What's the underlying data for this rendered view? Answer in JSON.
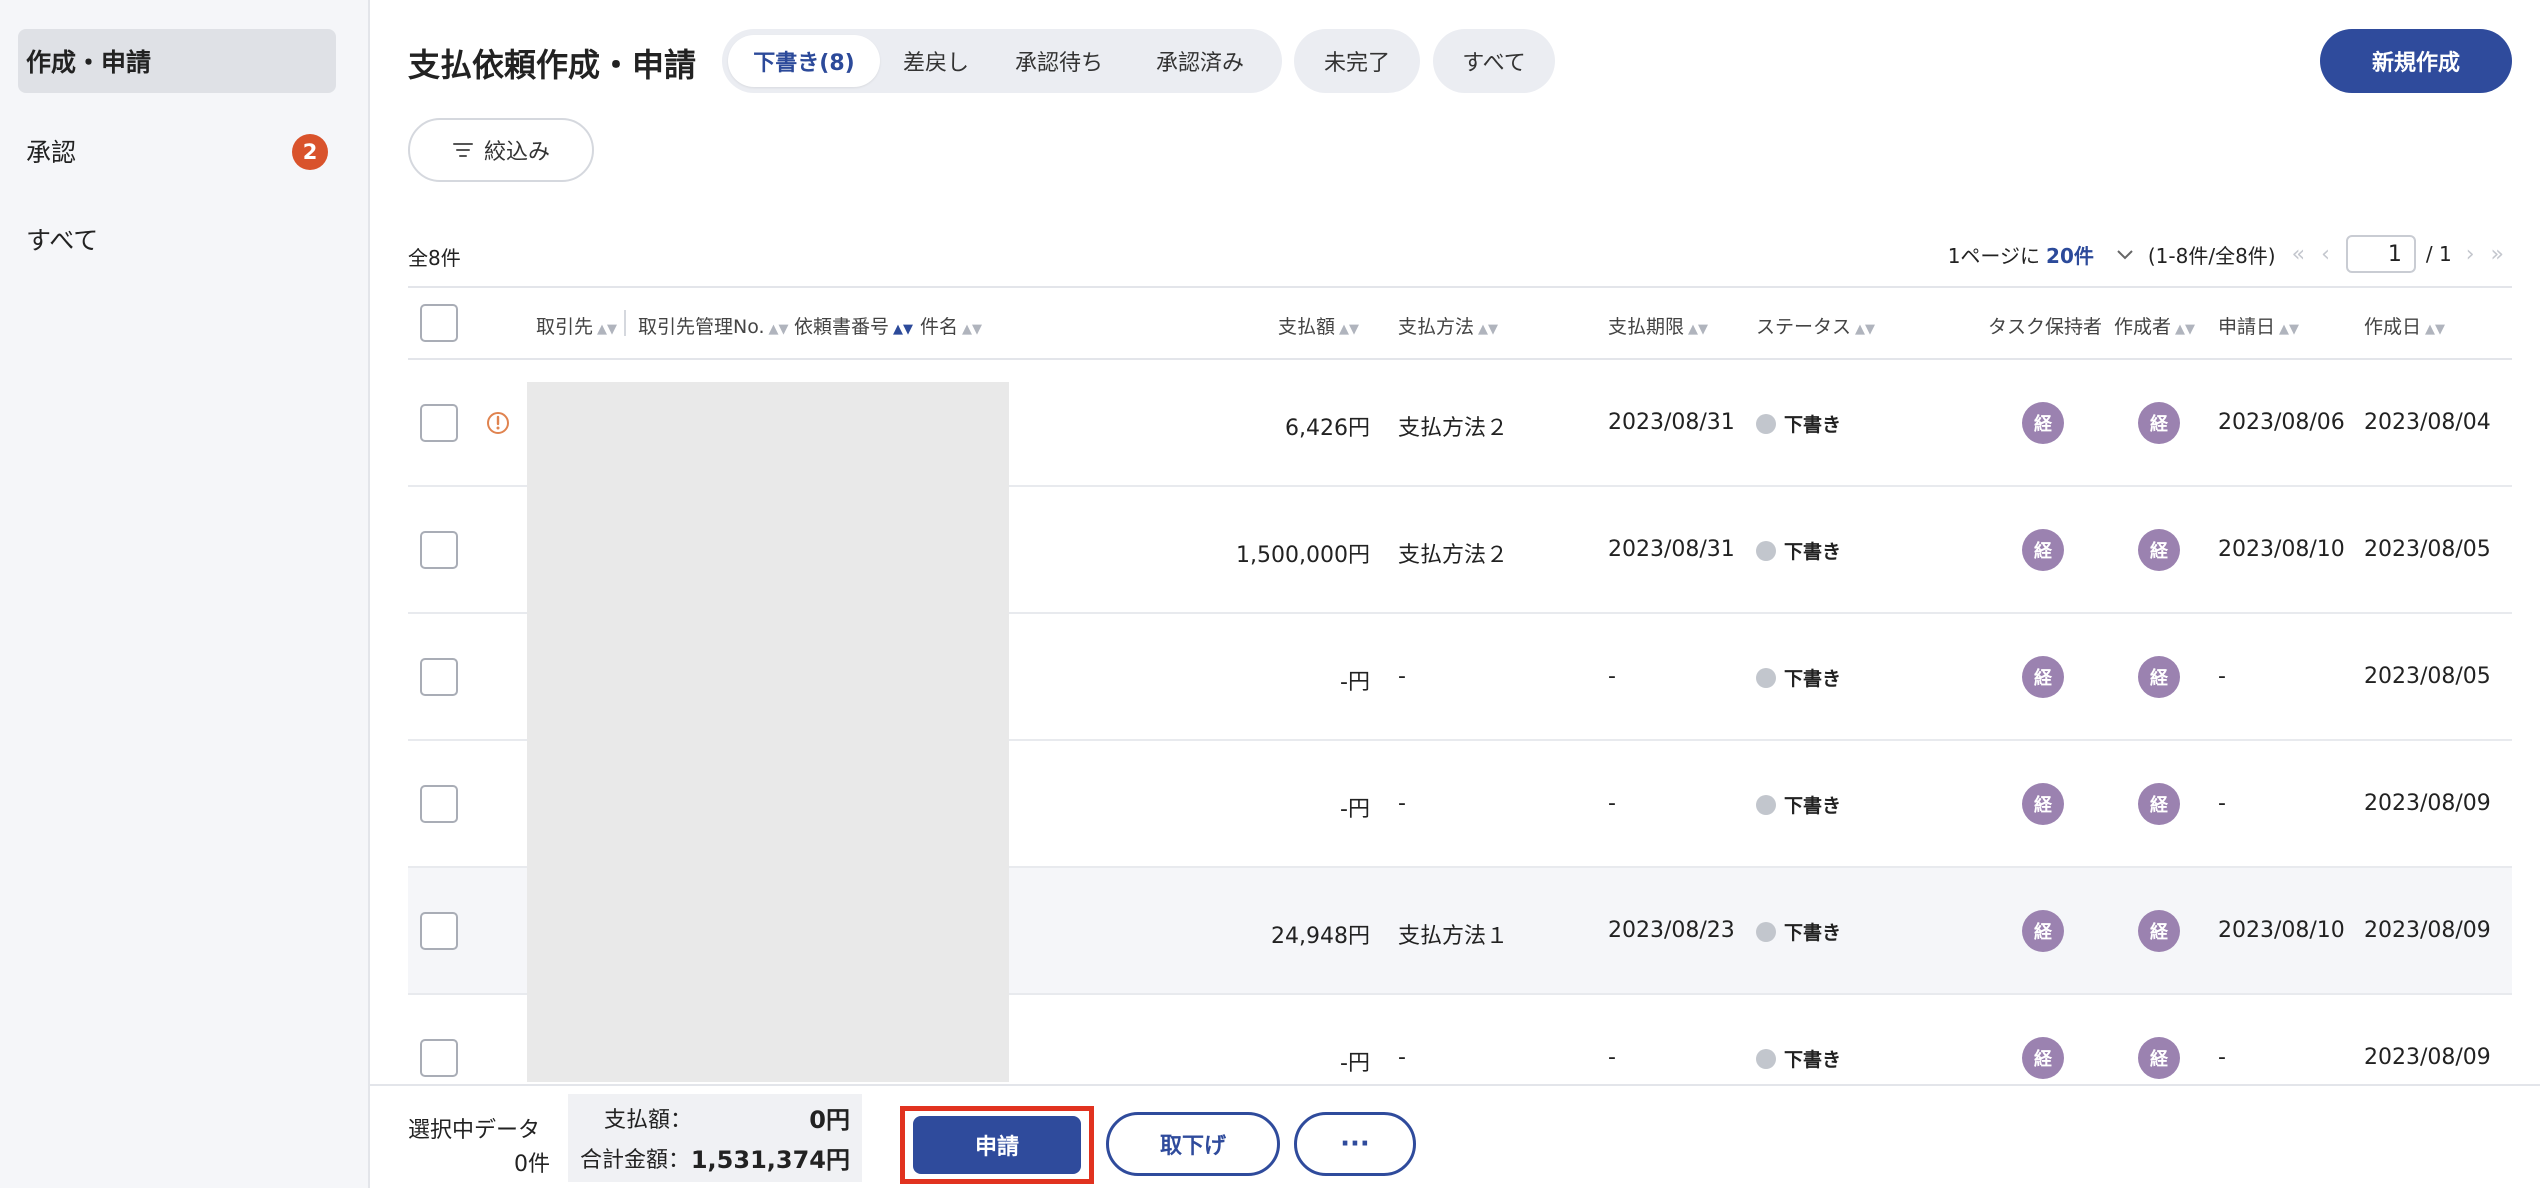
{
  "sidebar": {
    "items": [
      {
        "label": "作成・申請"
      },
      {
        "label": "承認",
        "badge": "2"
      },
      {
        "label": "すべて"
      }
    ]
  },
  "header": {
    "title": "支払依頼作成・申請",
    "tabs": [
      {
        "label": "下書き(8)"
      },
      {
        "label": "差戻し"
      },
      {
        "label": "承認待ち"
      },
      {
        "label": "承認済み"
      }
    ],
    "pills": [
      {
        "label": "未完了"
      },
      {
        "label": "すべて"
      }
    ],
    "new_button": "新規作成",
    "filter_button": "絞込み"
  },
  "list": {
    "total": "全8件",
    "per_page_prefix": "1ページに",
    "per_page_value": "20件",
    "range": "(1-8件/全8件)",
    "page_current": "1",
    "page_total": "/ 1"
  },
  "table": {
    "headers": {
      "vendor": "取引先",
      "vendor_no": "取引先管理No.",
      "request_no": "依頼書番号",
      "subject": "件名",
      "amount": "支払額",
      "method": "支払方法",
      "due": "支払期限",
      "status": "ステータス",
      "task_holder": "タスク保持者",
      "creator": "作成者",
      "applied": "申請日",
      "created": "作成日"
    },
    "rows": [
      {
        "amount": "6,426円",
        "method": "支払方法２",
        "due": "2023/08/31",
        "status": "下書き",
        "holder": "経",
        "creator": "経",
        "applied": "2023/08/06",
        "created": "2023/08/04"
      },
      {
        "amount": "1,500,000円",
        "method": "支払方法２",
        "due": "2023/08/31",
        "status": "下書き",
        "holder": "経",
        "creator": "経",
        "applied": "2023/08/10",
        "created": "2023/08/05"
      },
      {
        "amount": "-円",
        "method": "-",
        "due": "-",
        "status": "下書き",
        "holder": "経",
        "creator": "経",
        "applied": "-",
        "created": "2023/08/05"
      },
      {
        "amount": "-円",
        "method": "-",
        "due": "-",
        "status": "下書き",
        "holder": "経",
        "creator": "経",
        "applied": "-",
        "created": "2023/08/09"
      },
      {
        "amount": "24,948円",
        "method": "支払方法１",
        "due": "2023/08/23",
        "status": "下書き",
        "holder": "経",
        "creator": "経",
        "applied": "2023/08/10",
        "created": "2023/08/09"
      },
      {
        "amount": "-円",
        "method": "-",
        "due": "-",
        "status": "下書き",
        "holder": "経",
        "creator": "経",
        "applied": "-",
        "created": "2023/08/09"
      }
    ]
  },
  "bottom": {
    "selected_label": "選択中データ",
    "selected_count": "0件",
    "amount_label": "支払額：",
    "amount_value": "0円",
    "total_label": "合計金額：",
    "total_value": "1,531,374円",
    "apply_button": "申請",
    "withdraw_button": "取下げ",
    "more_button": "···"
  },
  "colors": {
    "primary": "#2f4b9c",
    "badge": "#d9532c",
    "avatar": "#9b82b0",
    "highlight_frame": "#e1321f"
  }
}
